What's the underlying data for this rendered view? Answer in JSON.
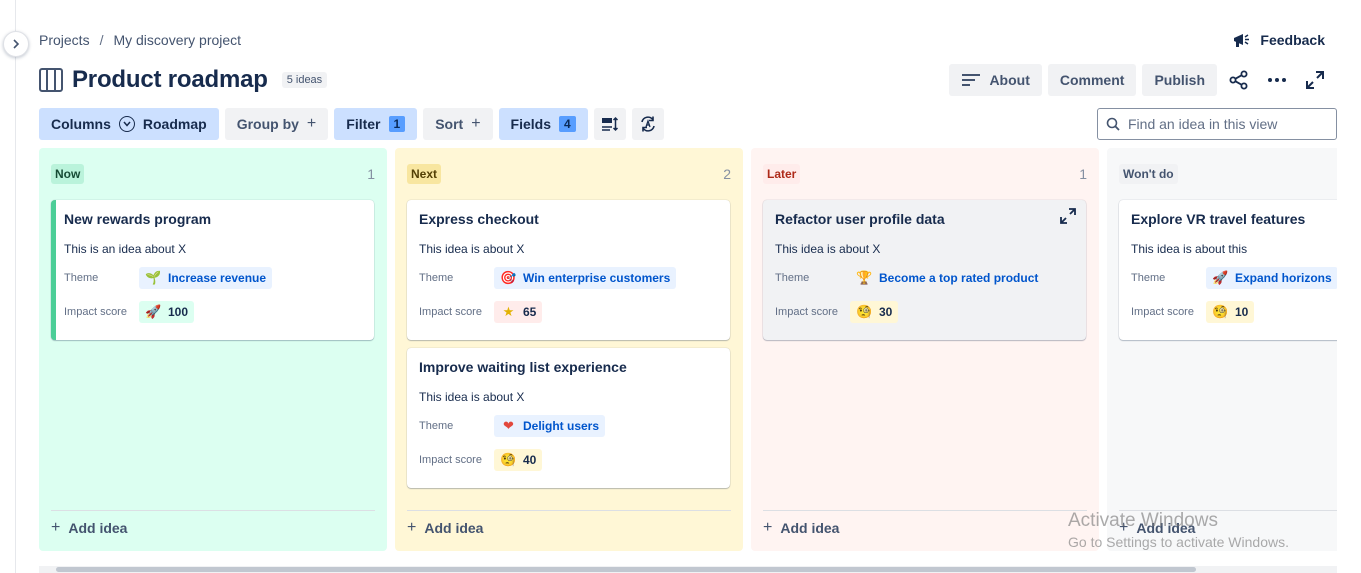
{
  "breadcrumb": {
    "projects": "Projects",
    "separator": "/",
    "project": "My discovery project"
  },
  "feedback_label": "Feedback",
  "page": {
    "title": "Product roadmap",
    "idea_count": "5 ideas"
  },
  "header_actions": {
    "about": "About",
    "comment": "Comment",
    "publish": "Publish"
  },
  "toolbar": {
    "columns": "Columns",
    "roadmap": "Roadmap",
    "group_by": "Group by",
    "filter": "Filter",
    "filter_count": "1",
    "sort": "Sort",
    "fields": "Fields",
    "fields_count": "4",
    "plus": "+"
  },
  "search": {
    "placeholder": "Find an idea in this view"
  },
  "labels": {
    "theme": "Theme",
    "impact": "Impact score",
    "add_idea": "Add idea",
    "add_plus": "+"
  },
  "columns": [
    {
      "name": "Now",
      "count": "1",
      "cards": [
        {
          "title": "New rewards program",
          "desc": "This is an idea about X",
          "theme_icon": "🌱",
          "theme": "Increase revenue",
          "score_icon": "🚀",
          "score": "100"
        }
      ]
    },
    {
      "name": "Next",
      "count": "2",
      "cards": [
        {
          "title": "Express checkout",
          "desc": "This idea is about X",
          "theme_icon": "🎯",
          "theme": "Win enterprise customers",
          "score_icon": "★",
          "score": "65"
        },
        {
          "title": "Improve waiting list experience",
          "desc": "This idea is about X",
          "theme_icon": "❤",
          "theme": "Delight users",
          "score_icon": "🧐",
          "score": "40"
        }
      ]
    },
    {
      "name": "Later",
      "count": "1",
      "cards": [
        {
          "title": "Refactor user profile data",
          "desc": "This idea is about X",
          "theme_icon": "🏆",
          "theme": "Become a top rated product",
          "score_icon": "🧐",
          "score": "30"
        }
      ]
    },
    {
      "name": "Won't do",
      "count": "",
      "cards": [
        {
          "title": "Explore VR travel features",
          "desc": "This idea is about this",
          "theme_icon": "🚀",
          "theme": "Expand horizons",
          "score_icon": "🧐",
          "score": "10"
        }
      ]
    }
  ],
  "watermark": {
    "line1": "Activate Windows",
    "line2": "Go to Settings to activate Windows."
  },
  "colors": {
    "now_bg": "#dcfff1",
    "now_lozenge": "#baf3db",
    "now_text": "#164b35",
    "next_bg": "#fff7d6",
    "next_lozenge": "#f8e6a0",
    "next_text": "#533f04",
    "later_bg": "#fff4f2",
    "later_lozenge": "#ffeceb",
    "later_text": "#ae2a19",
    "wont_bg": "#f7f8f9",
    "wont_lozenge": "#f1f2f4",
    "wont_text": "#44546f",
    "score_high": "#dcfff1",
    "score_mid": "#ffeceb",
    "score_low": "#fff7d6"
  }
}
